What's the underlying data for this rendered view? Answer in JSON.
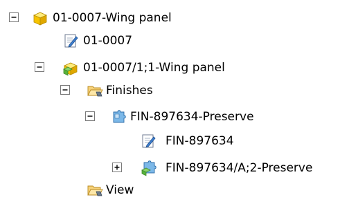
{
  "tree": {
    "nodes": [
      {
        "label": "01-0007-Wing panel",
        "icon": "item-yellow-cube-icon",
        "toggle": "collapse"
      },
      {
        "label": "01-0007",
        "icon": "document-edit-icon",
        "toggle": "none"
      },
      {
        "label": "01-0007/1;1-Wing panel",
        "icon": "item-revision-cube-icon",
        "toggle": "collapse"
      },
      {
        "label": "Finishes",
        "icon": "open-folder-icon",
        "toggle": "collapse"
      },
      {
        "label": "FIN-897634-Preserve",
        "icon": "puzzle-item-icon",
        "toggle": "collapse"
      },
      {
        "label": "FIN-897634",
        "icon": "document-edit-icon",
        "toggle": "none"
      },
      {
        "label": "FIN-897634/A;2-Preserve",
        "icon": "puzzle-revision-icon",
        "toggle": "expand"
      },
      {
        "label": "View",
        "icon": "open-folder-icon",
        "toggle": "none"
      }
    ]
  }
}
